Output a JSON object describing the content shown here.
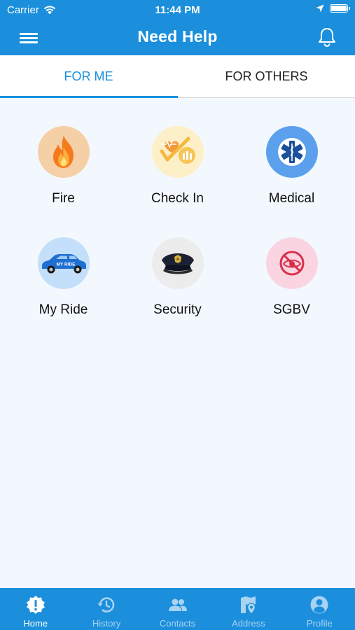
{
  "status_bar": {
    "carrier": "Carrier",
    "time": "11:44 PM"
  },
  "header": {
    "title": "Need Help",
    "menu_icon": "hamburger-icon",
    "notification_icon": "bell-icon"
  },
  "tabs": [
    {
      "label": "FOR ME",
      "active": true
    },
    {
      "label": "FOR OTHERS",
      "active": false
    }
  ],
  "categories": [
    {
      "label": "Fire",
      "icon": "fire-icon",
      "bg": "#f5cfa6"
    },
    {
      "label": "Check In",
      "icon": "check-in-icon",
      "bg": "#fdf0c8"
    },
    {
      "label": "Medical",
      "icon": "medical-star-icon",
      "bg": "#5aa0ec"
    },
    {
      "label": "My Ride",
      "icon": "car-icon",
      "bg": "#c3dffa",
      "badge": "MY RIDE"
    },
    {
      "label": "Security",
      "icon": "police-cap-icon",
      "bg": "#ececec"
    },
    {
      "label": "SGBV",
      "icon": "no-violence-icon",
      "bg": "#fbd4e2"
    }
  ],
  "bottom_nav": [
    {
      "label": "Home",
      "icon": "alert-badge-icon",
      "active": true
    },
    {
      "label": "History",
      "icon": "history-icon",
      "active": false
    },
    {
      "label": "Contacts",
      "icon": "contacts-icon",
      "active": false
    },
    {
      "label": "Address",
      "icon": "address-icon",
      "active": false
    },
    {
      "label": "Profile",
      "icon": "profile-icon",
      "active": false
    }
  ],
  "colors": {
    "primary": "#1b8fdc",
    "background": "#f2f8fd",
    "inactive_nav": "#a9d3f2"
  }
}
